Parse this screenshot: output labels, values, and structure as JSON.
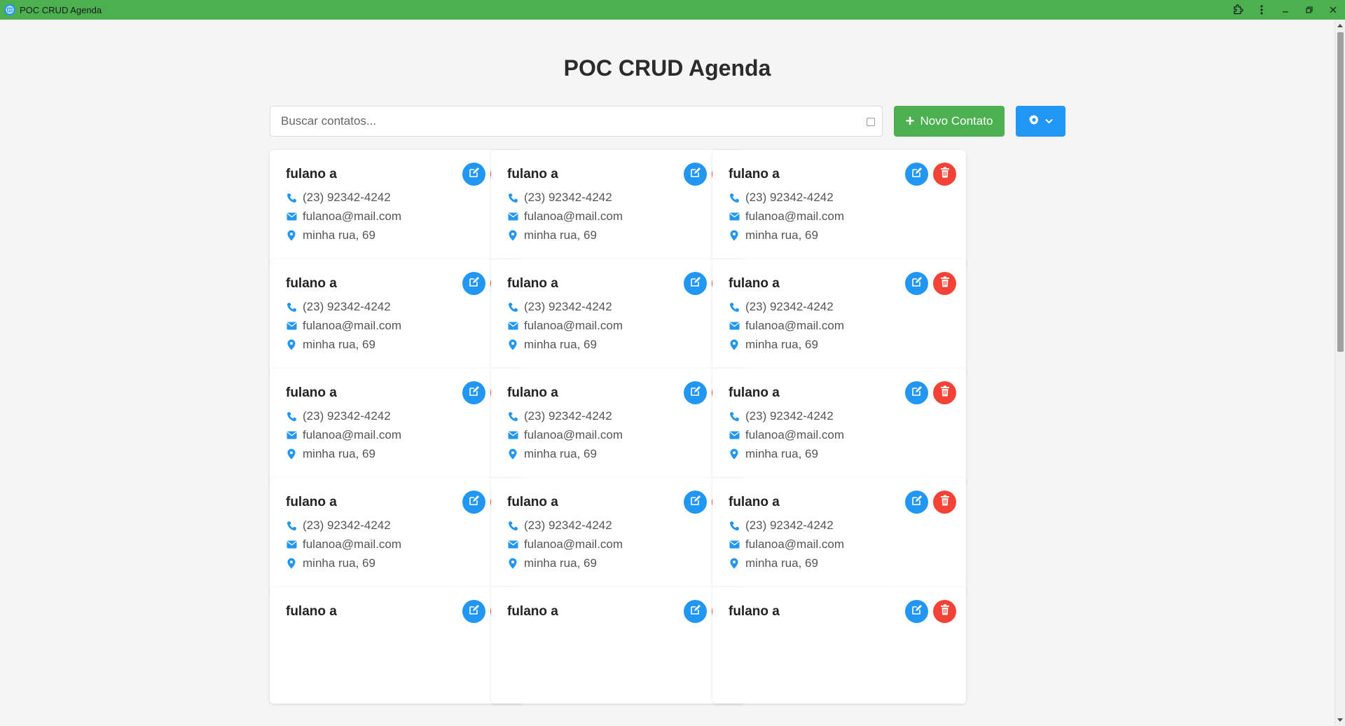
{
  "window": {
    "title": "POC CRUD Agenda",
    "app_icon": "globe-icon",
    "controls": [
      "extensions-icon",
      "more-vert-icon",
      "minimize-icon",
      "restore-icon",
      "close-icon"
    ]
  },
  "header": {
    "title": "POC CRUD Agenda"
  },
  "toolbar": {
    "search_placeholder": "Buscar contatos...",
    "search_value": "",
    "new_contact_label": "Novo Contato",
    "settings_icon": "gear-icon",
    "settings_caret": "chevron-down-icon"
  },
  "colors": {
    "titlebar": "#4caf50",
    "primary_green": "#4caf50",
    "primary_blue": "#2196f3",
    "danger_red": "#f44336",
    "background": "#f5f5f5"
  },
  "contacts": [
    {
      "name": "fulano a",
      "phone": "(23) 92342-4242",
      "email": "fulanoa@mail.com",
      "address": "minha rua, 69"
    },
    {
      "name": "fulano a",
      "phone": "(23) 92342-4242",
      "email": "fulanoa@mail.com",
      "address": "minha rua, 69"
    },
    {
      "name": "fulano a",
      "phone": "(23) 92342-4242",
      "email": "fulanoa@mail.com",
      "address": "minha rua, 69"
    },
    {
      "name": "fulano a",
      "phone": "(23) 92342-4242",
      "email": "fulanoa@mail.com",
      "address": "minha rua, 69"
    },
    {
      "name": "fulano a",
      "phone": "(23) 92342-4242",
      "email": "fulanoa@mail.com",
      "address": "minha rua, 69"
    },
    {
      "name": "fulano a",
      "phone": "(23) 92342-4242",
      "email": "fulanoa@mail.com",
      "address": "minha rua, 69"
    },
    {
      "name": "fulano a",
      "phone": "(23) 92342-4242",
      "email": "fulanoa@mail.com",
      "address": "minha rua, 69"
    },
    {
      "name": "fulano a",
      "phone": "(23) 92342-4242",
      "email": "fulanoa@mail.com",
      "address": "minha rua, 69"
    },
    {
      "name": "fulano a",
      "phone": "(23) 92342-4242",
      "email": "fulanoa@mail.com",
      "address": "minha rua, 69"
    },
    {
      "name": "fulano a",
      "phone": "(23) 92342-4242",
      "email": "fulanoa@mail.com",
      "address": "minha rua, 69"
    },
    {
      "name": "fulano a",
      "phone": "(23) 92342-4242",
      "email": "fulanoa@mail.com",
      "address": "minha rua, 69"
    },
    {
      "name": "fulano a",
      "phone": "(23) 92342-4242",
      "email": "fulanoa@mail.com",
      "address": "minha rua, 69"
    },
    {
      "name": "fulano a"
    },
    {
      "name": "fulano a"
    },
    {
      "name": "fulano a"
    }
  ]
}
